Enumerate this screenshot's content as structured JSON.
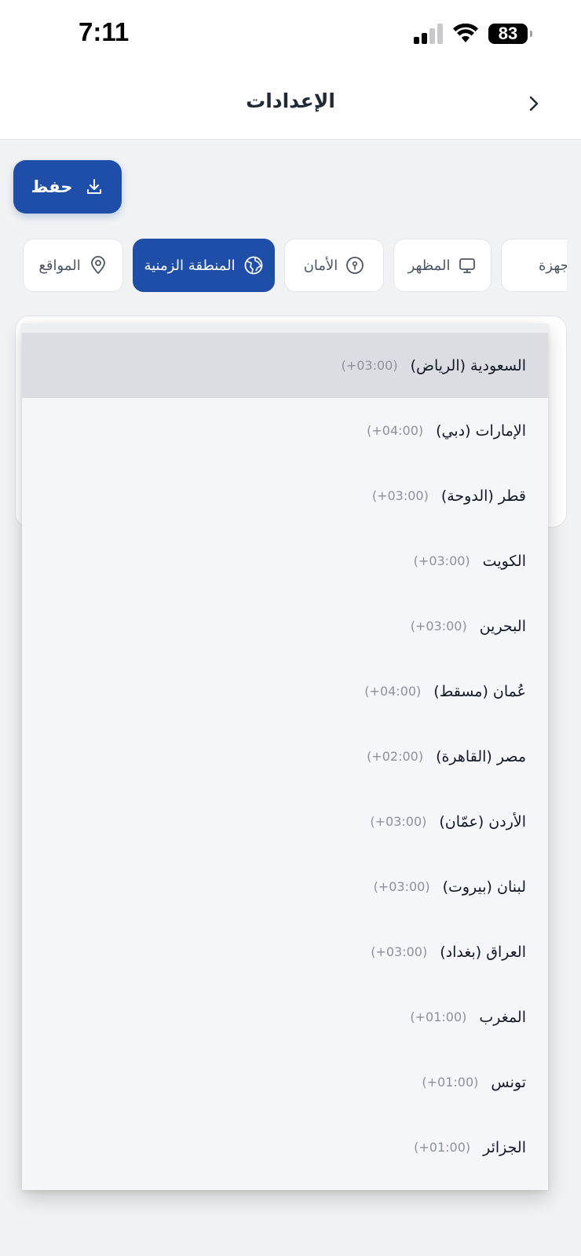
{
  "status_bar": {
    "time": "7:11",
    "battery": "83"
  },
  "header": {
    "title": "الإعدادات"
  },
  "toolbar": {
    "save_label": "حفظ"
  },
  "tabs": [
    {
      "label": "المواقع",
      "icon": "location-pin-icon",
      "active": false
    },
    {
      "label": "المنطقة الزمنية",
      "icon": "globe-icon",
      "active": true
    },
    {
      "label": "الأمان",
      "icon": "security-icon",
      "active": false
    },
    {
      "label": "المظهر",
      "icon": "monitor-icon",
      "active": false
    },
    {
      "label": "ن الأجهزة",
      "icon": "",
      "active": false
    }
  ],
  "timezones": [
    {
      "name": "السعودية (الرياض)",
      "offset": "(+03:00)",
      "selected": true
    },
    {
      "name": "الإمارات (دبي)",
      "offset": "(+04:00)"
    },
    {
      "name": "قطر (الدوحة)",
      "offset": "(+03:00)"
    },
    {
      "name": "الكويت",
      "offset": "(+03:00)"
    },
    {
      "name": "البحرين",
      "offset": "(+03:00)"
    },
    {
      "name": "عُمان (مسقط)",
      "offset": "(+04:00)"
    },
    {
      "name": "مصر (القاهرة)",
      "offset": "(+02:00)"
    },
    {
      "name": "الأردن (عمّان)",
      "offset": "(+03:00)"
    },
    {
      "name": "لبنان (بيروت)",
      "offset": "(+03:00)"
    },
    {
      "name": "العراق (بغداد)",
      "offset": "(+03:00)"
    },
    {
      "name": "المغرب",
      "offset": "(+01:00)"
    },
    {
      "name": "تونس",
      "offset": "(+01:00)"
    },
    {
      "name": "الجزائر",
      "offset": "(+01:00)"
    }
  ],
  "colors": {
    "accent": "#1f4ea8",
    "selected_row": "#dcdde2",
    "background": "#f1f2f4"
  }
}
